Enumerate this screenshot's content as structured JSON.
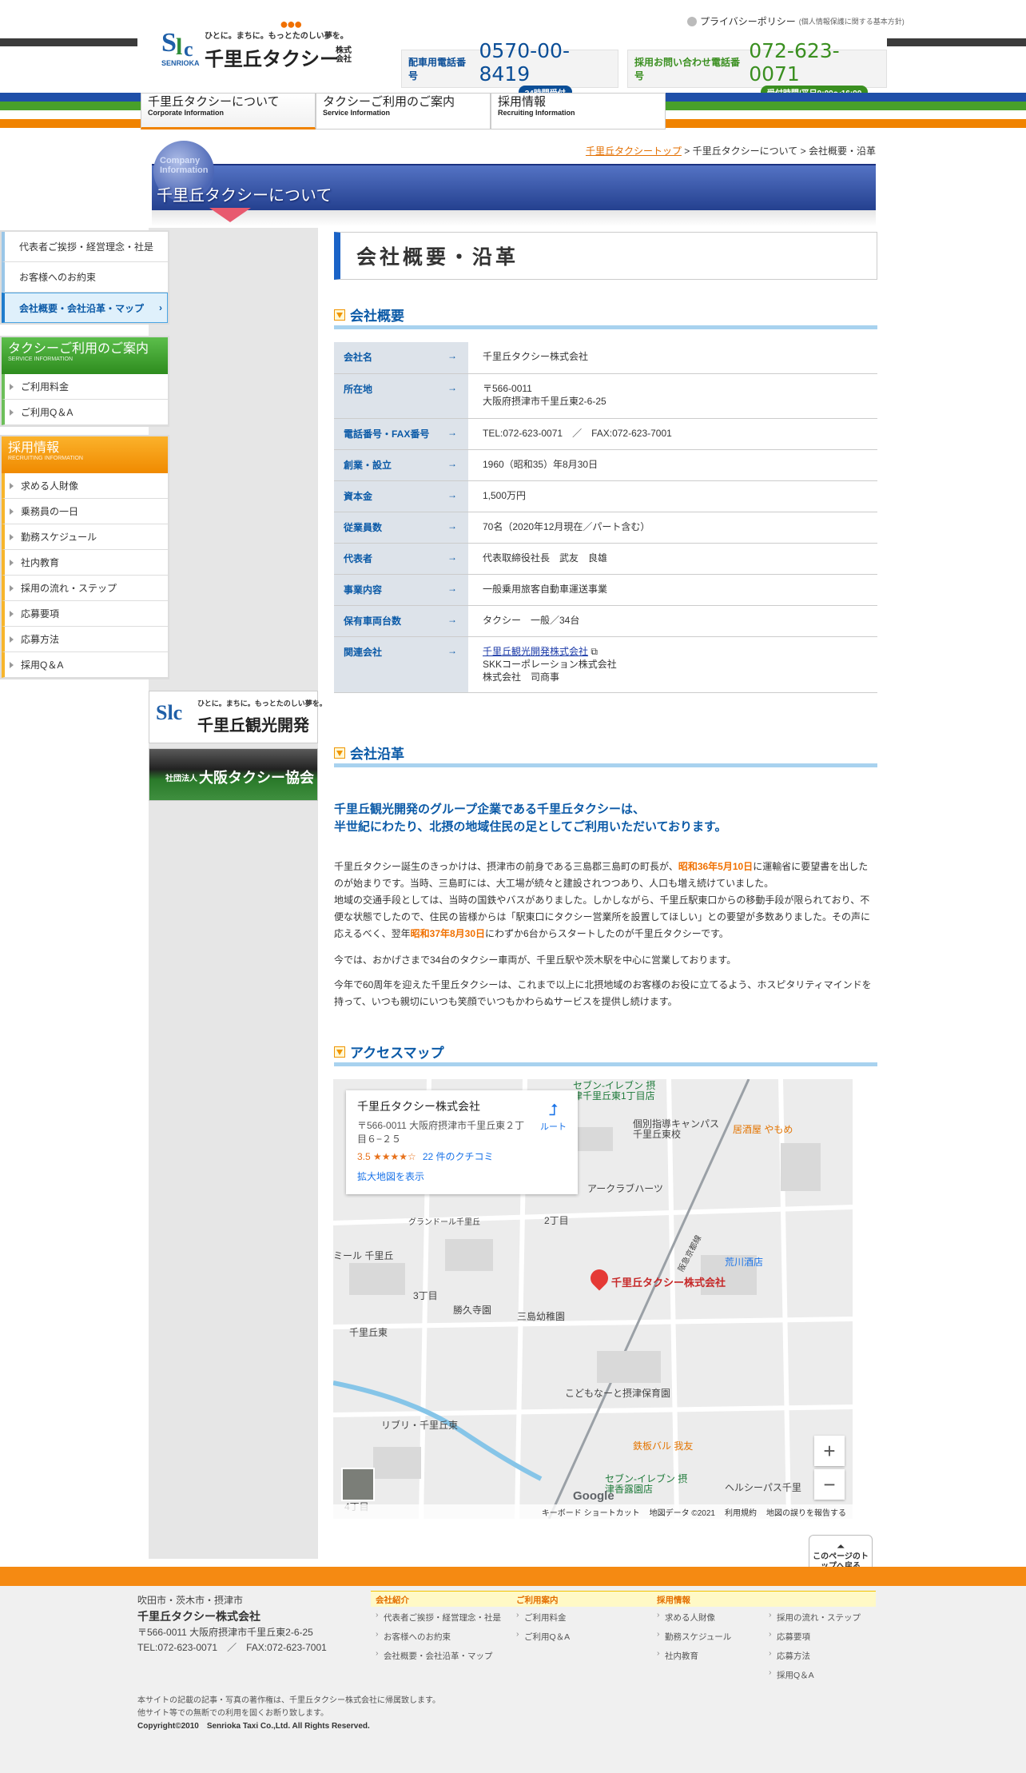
{
  "header": {
    "logo_tagline": "ひとに。まちに。もっとたのしい夢を。",
    "logo_name": "千里丘タクシー",
    "logo_suffix": "株式会社",
    "logo_roman": "SENRIOKA",
    "privacy_label": "プライバシーポリシー",
    "privacy_sub": "(個人情報保護に関する基本方針)",
    "tel1_label": "配車用電話番号",
    "tel1_number": "0570-00-8419",
    "tel1_sub": "24時間受付",
    "tel2_label": "採用お問い合わせ電話番号",
    "tel2_number": "072-623-0071",
    "tel2_sub": "受付時間/平日9:00～16:00"
  },
  "nav": [
    {
      "jp": "千里丘タクシーについて",
      "en": "Corporate Information"
    },
    {
      "jp": "タクシーご利用のご案内",
      "en": "Service Information"
    },
    {
      "jp": "採用情報",
      "en": "Recruiting Information"
    }
  ],
  "breadcrumb": {
    "home": "千里丘タクシートップ",
    "sep1": " > ",
    "mid": "千里丘タクシーについて",
    "sep2": " > ",
    "current": "会社概要・沿革"
  },
  "banner": {
    "en": "Company Information",
    "title": "千里丘タクシーについて"
  },
  "sidebar": {
    "about": [
      "代表者ご挨拶・経営理念・社是",
      "お客様へのお約束",
      "会社概要・会社沿革・マップ"
    ],
    "service_head": "タクシーご利用のご案内",
    "service_head_en": "SERVICE INFORMATION",
    "service": [
      "ご利用料金",
      "ご利用Q＆A"
    ],
    "recruit_head": "採用情報",
    "recruit_head_en": "RECRUITING INFORMATION",
    "recruit": [
      "求める人財像",
      "乗務員の一日",
      "勤務スケジュール",
      "社内教育",
      "採用の流れ・ステップ",
      "応募要項",
      "応募方法",
      "採用Q＆A"
    ],
    "banner1": "千里丘観光開発",
    "banner1_tag": "ひとに。まちに。もっとたのしい夢を。",
    "banner2": "大阪タクシー協会",
    "banner2_pre": "社団法人"
  },
  "main": {
    "title": "会社概要・沿革",
    "h_overview": "会社概要",
    "overview": [
      {
        "k": "会社名",
        "v": "千里丘タクシー株式会社"
      },
      {
        "k": "所在地",
        "v": "〒566-0011",
        "v2": "大阪府摂津市千里丘東2-6-25"
      },
      {
        "k": "電話番号・FAX番号",
        "v": "TEL:072-623-0071　／　FAX:072-623-7001"
      },
      {
        "k": "創業・設立",
        "v": "1960（昭和35）年8月30日"
      },
      {
        "k": "資本金",
        "v": "1,500万円"
      },
      {
        "k": "従業員数",
        "v": "70名（2020年12月現在／パート含む）"
      },
      {
        "k": "代表者",
        "v": "代表取締役社長　武友　良雄"
      },
      {
        "k": "事業内容",
        "v": "一般乗用旅客自動車運送事業"
      },
      {
        "k": "保有車両台数",
        "v": "タクシー　一般／34台"
      },
      {
        "k": "関連会社",
        "link": "千里丘観光開発株式会社",
        "v2": "SKKコーポレーション株式会社",
        "v3": "株式会社　司商事"
      }
    ],
    "h_history": "会社沿革",
    "lead1": "千里丘観光開発のグループ企業である千里丘タクシーは、",
    "lead2": "半世紀にわたり、北摂の地域住民の足としてご利用いただいております。",
    "p1a": "千里丘タクシー誕生のきっかけは、摂津市の前身である三島郡三島町の町長が、",
    "p1hl": "昭和36年5月10日",
    "p1b": "に運輸省に要望書を出したのが始まりです。当時、三島町には、大工場が続々と建設されつつあり、人口も増え続けていました。",
    "p1c": "地域の交通手段としては、当時の国鉄やバスがありました。しかしながら、千里丘駅東口からの移動手段が限られており、不便な状態でしたので、住民の皆様からは「駅東口にタクシー営業所を設置してほしい」との要望が多数ありました。その声に応えるべく、翌年",
    "p1hl2": "昭和37年8月30日",
    "p1d": "にわずか6台からスタートしたのが千里丘タクシーです。",
    "p2": "今では、おかげさまで34台のタクシー車両が、千里丘駅や茨木駅を中心に営業しております。",
    "p3": "今年で60周年を迎えた千里丘タクシーは、これまで以上に北摂地域のお客様のお役に立てるよう、ホスピタリティマインドを持って、いつも親切にいつも笑顔でいつもかわらぬサービスを提供し続けます。",
    "h_access": "アクセスマップ"
  },
  "map": {
    "card_title": "千里丘タクシー株式会社",
    "card_addr": "〒566-0011 大阪府摂津市千里丘東２丁目６−２５",
    "rating": "3.5 ★★★★☆",
    "reviews": "22 件のクチコミ",
    "enlarge": "拡大地図を表示",
    "route": "ルート",
    "pin_label": "千里丘タクシー株式会社",
    "labels": [
      "セブン-イレブン 摂津千里丘東1丁目店",
      "個別指導キャンパス 千里丘東校",
      "居酒屋 やもめ",
      "三島幼稚園",
      "勝久寺園",
      "こどもなーと摂津保育園",
      "リブリ・千里丘東",
      "鉄板バル 我友",
      "セブン-イレブン 摂津香露園店",
      "ヘルシーパス千里",
      "荒川酒店",
      "2丁目",
      "3丁目",
      "4丁目",
      "千里丘東",
      "グランドール千里丘",
      "ミール 千里丘",
      "阪急京都線",
      "アークラブハーツ"
    ],
    "footer": [
      "キーボード ショートカット",
      "地図データ ©2021",
      "利用規約",
      "地図の誤りを報告する"
    ],
    "google": "Google",
    "zoom_in": "+",
    "zoom_out": "−"
  },
  "pagetop": "このページのトップへ戻る",
  "footer": {
    "area": "吹田市・茨木市・摂津市",
    "name": "千里丘タクシー株式会社",
    "addr": "〒566-0011 大阪府摂津市千里丘東2-6-25",
    "tel": "TEL:072-623-0071　／　FAX:072-623-7001",
    "col1_head": "会社紹介",
    "col1": [
      "代表者ご挨拶・経営理念・社是",
      "お客様へのお約束",
      "会社概要・会社沿革・マップ"
    ],
    "col2_head": "ご利用案内",
    "col2": [
      "ご利用料金",
      "ご利用Q＆A"
    ],
    "col3_head": "採用情報",
    "col3a": [
      "求める人財像",
      "勤務スケジュール",
      "社内教育"
    ],
    "col3b": [
      "採用の流れ・ステップ",
      "応募要項",
      "応募方法",
      "採用Q＆A"
    ],
    "copy1": "本サイトの記載の記事・写真の著作権は、千里丘タクシー株式会社に帰属致します。",
    "copy2": "他サイト等での無断での利用を固くお断り致します。",
    "copyright": "Copyright©2010　Senrioka Taxi Co.,Ltd. All Rights Reserved."
  },
  "colors": {
    "brand_blue": "#0b5aa7",
    "orange": "#f08300",
    "green": "#3a8f20"
  }
}
